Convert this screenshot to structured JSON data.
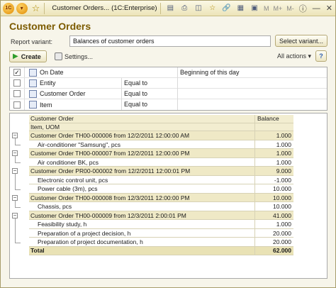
{
  "window": {
    "title": "Customer Orders...",
    "app": "(1C:Enterprise)",
    "toolbar_buttons": [
      "M",
      "M+",
      "M-"
    ],
    "logo": "1C"
  },
  "form": {
    "title": "Customer Orders",
    "report_variant_label": "Report variant:",
    "report_variant_value": "Balances of customer orders",
    "select_variant_label": "Select variant...",
    "create_label": "Create",
    "settings_label": "Settings...",
    "all_actions_label": "All actions ▾",
    "help_label": "?"
  },
  "settings": [
    {
      "checked": true,
      "checkmark": "✓",
      "name": "On Date",
      "condition": "",
      "value": "Beginning of this day"
    },
    {
      "checked": false,
      "checkmark": "",
      "name": "Entity",
      "condition": "Equal to",
      "value": ""
    },
    {
      "checked": false,
      "checkmark": "",
      "name": "Customer Order",
      "condition": "Equal to",
      "value": ""
    },
    {
      "checked": false,
      "checkmark": "",
      "name": "Item",
      "condition": "Equal to",
      "value": ""
    }
  ],
  "report": {
    "headers": {
      "col1": "Customer Order",
      "col1b": "Item, UOM",
      "col2": "Balance"
    },
    "rows": [
      {
        "type": "group",
        "name": "Customer Order TH00-000006 from 12/2/2011 12:00:00 AM",
        "balance": "1.000"
      },
      {
        "type": "item",
        "name": "Air-conditioner \"Samsung\", pcs",
        "balance": "1.000"
      },
      {
        "type": "group",
        "name": "Customer Order TH00-000007 from 12/2/2011 12:00:00 PM",
        "balance": "1.000"
      },
      {
        "type": "item",
        "name": "Air conditioner BK, pcs",
        "balance": "1.000"
      },
      {
        "type": "group",
        "name": "Customer Order PR00-000002 from 12/2/2011 12:00:01 PM",
        "balance": "9.000"
      },
      {
        "type": "item",
        "name": "Electronic control unit, pcs",
        "balance": "-1.000"
      },
      {
        "type": "item",
        "name": "Power cable (3m), pcs",
        "balance": "10.000"
      },
      {
        "type": "group",
        "name": "Customer Order TH00-000008 from 12/3/2011 12:00:00 PM",
        "balance": "10.000"
      },
      {
        "type": "item",
        "name": "Chassis, pcs",
        "balance": "10.000"
      },
      {
        "type": "group",
        "name": "Customer Order TH00-000009 from 12/3/2011 2:00:01 PM",
        "balance": "41.000"
      },
      {
        "type": "item",
        "name": "Feasibility study, h",
        "balance": "1.000"
      },
      {
        "type": "item",
        "name": "Preparation of a project decision, h",
        "balance": "20.000"
      },
      {
        "type": "item",
        "name": "Preparation of project documentation, h",
        "balance": "20.000"
      }
    ],
    "total": {
      "name": "Total",
      "balance": "62.000"
    }
  }
}
